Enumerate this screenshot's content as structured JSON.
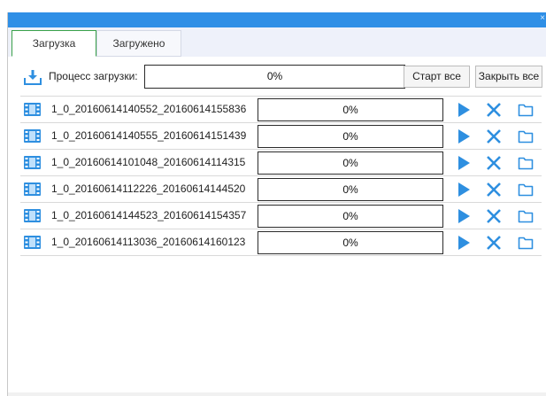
{
  "window": {
    "close_glyph": "×"
  },
  "tabs": [
    {
      "label": "Загрузка",
      "active": true
    },
    {
      "label": "Загружено",
      "active": false
    }
  ],
  "overall": {
    "icon": "download-icon",
    "label": "Процесс загрузки:",
    "progress_text": "0%",
    "progress": 0
  },
  "buttons": {
    "start_all": "Старт все",
    "close_all": "Закрыть все"
  },
  "files": [
    {
      "name": "1_0_20160614140552_20160614155836",
      "progress_text": "0%",
      "progress": 0
    },
    {
      "name": "1_0_20160614140555_20160614151439",
      "progress_text": "0%",
      "progress": 0
    },
    {
      "name": "1_0_20160614101048_20160614114315",
      "progress_text": "0%",
      "progress": 0
    },
    {
      "name": "1_0_20160614112226_20160614144520",
      "progress_text": "0%",
      "progress": 0
    },
    {
      "name": "1_0_20160614144523_20160614154357",
      "progress_text": "0%",
      "progress": 0
    },
    {
      "name": "1_0_20160614113036_20160614160123",
      "progress_text": "0%",
      "progress": 0
    }
  ],
  "icons": {
    "file": "film-icon",
    "play": "play-icon",
    "remove": "close-icon",
    "folder": "folder-icon"
  },
  "colors": {
    "accent": "#2f8fe6",
    "tab_active_border": "#3aa14a",
    "action": "#2e8fe0",
    "progress_fill": "#3aa14a"
  }
}
